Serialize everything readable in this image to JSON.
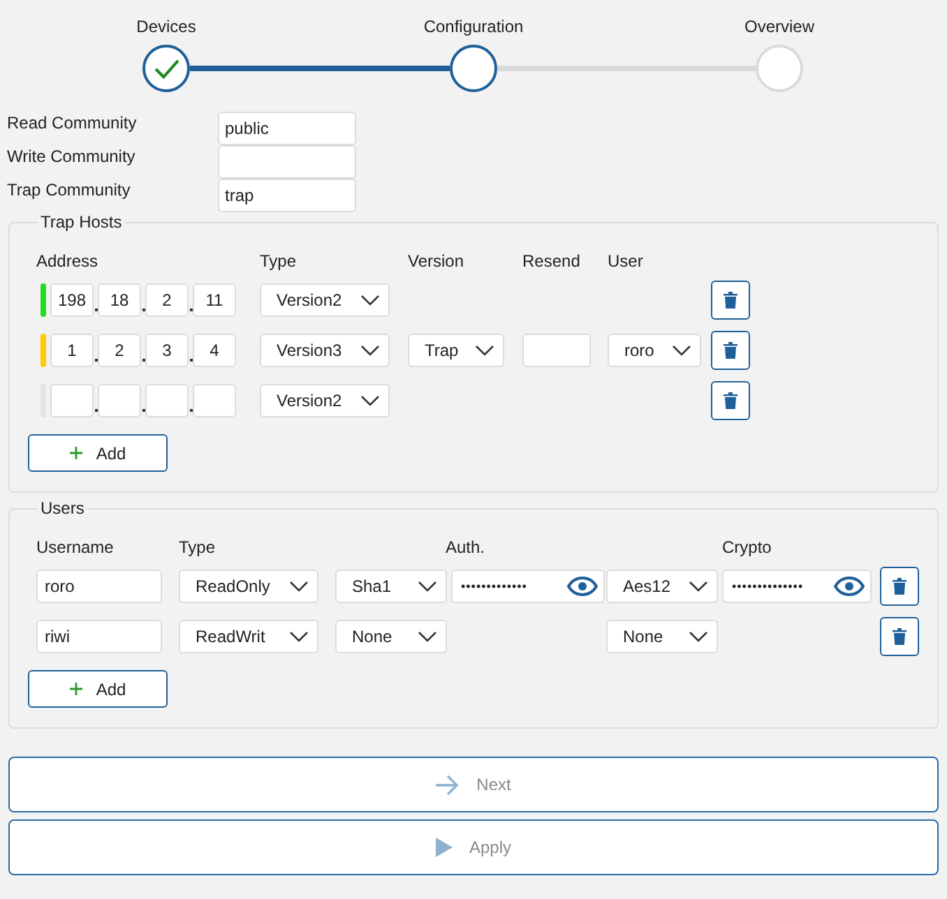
{
  "stepper": {
    "steps": [
      {
        "label": "Devices",
        "completed": true,
        "selected": false
      },
      {
        "label": "Configuration",
        "completed": false,
        "selected": true
      },
      {
        "label": "Overview",
        "completed": false,
        "selected": false
      }
    ]
  },
  "communities": [
    {
      "label": "Read Community",
      "value": "public"
    },
    {
      "label": "Write Community"
    },
    {
      "label": "Trap Community",
      "value": "trap"
    }
  ],
  "trap_hosts": {
    "title": "Trap Hosts",
    "columns": [
      "Address",
      "Type",
      "Version",
      "Resend",
      "User"
    ],
    "rows": [
      {
        "kind": "v2",
        "color": "#22dd22",
        "address": [
          "198",
          "18",
          "2",
          "11"
        ],
        "type": "Version2"
      },
      {
        "kind": "v3",
        "color": "#ffcc00",
        "address": [
          "1",
          "2",
          "3",
          "4"
        ],
        "type": "Version3",
        "version": "Trap",
        "user": "roro"
      },
      {
        "kind": "v2",
        "color": "#e3e3e3",
        "type": "Version2"
      }
    ],
    "add_label": "Add"
  },
  "users": {
    "title": "Users",
    "columns": [
      "Username",
      "Type",
      "Auth.",
      "Crypto"
    ],
    "rows": [
      {
        "username": "roro",
        "type": "ReadOnly",
        "auth": "Sha1",
        "auth_password": "•••••••••••••",
        "crypto": "Aes12",
        "crypto_password": "••••••••••••••"
      },
      {
        "username": "riwi",
        "type": "ReadWrit",
        "auth": "None",
        "crypto": "None"
      }
    ],
    "add_label": "Add"
  },
  "actions": [
    {
      "kind": "next",
      "label": "Next",
      "disabled": true
    },
    {
      "kind": "apply",
      "label": "Apply",
      "disabled": true
    }
  ]
}
